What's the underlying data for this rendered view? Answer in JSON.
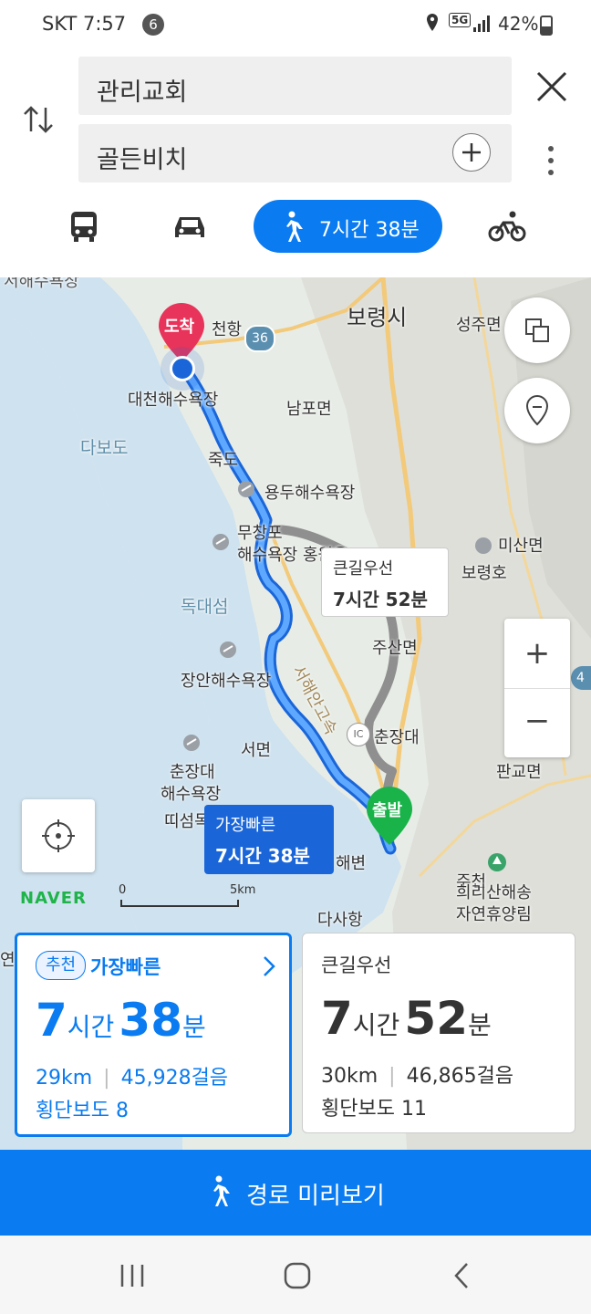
{
  "status": {
    "carrier": "SKT",
    "time": "7:57",
    "notification_count": "6",
    "network": "5G",
    "battery": "42%"
  },
  "search": {
    "origin": "관리교회",
    "destination": "골든비치"
  },
  "modes": {
    "walk_time": "7시간 38분"
  },
  "map": {
    "places": {
      "boryeong": "보령시",
      "seongju": "성주면",
      "cheonhang": "천항",
      "route36": "36",
      "daecheon_beach": "대천해수욕장",
      "dabodo": "다보도",
      "nampo": "남포면",
      "jukdo": "죽도",
      "yongdu_beach": "용두해수욕장",
      "muchangpo": "무창포",
      "muchangpo_beach": "해수욕장 홍원읍",
      "misan": "미산면",
      "boryeongho": "보령호",
      "dokdaeseom": "독대섬",
      "jusan": "주산면",
      "seohae_exp": "서해안고속",
      "janghang_beach": "장안해수욕장",
      "chunjang_dae": "춘장대",
      "seomyeon": "서면",
      "chunjang_beach1": "춘장대",
      "chunjang_beach2": "해수욕장",
      "ttiseom": "띠섬목해변",
      "hwaebyeon": "해변",
      "dasahang": "다사항",
      "pangyo": "판교면",
      "huirisan1": "희리산해송",
      "huirisan2": "자연휴양림",
      "jucheon": "주천",
      "ic": "IC",
      "yeon": "연",
      "top_cut": "서해수욕장",
      "route_left_small": "4"
    },
    "arrival_marker": "도착",
    "departure_marker": "출발",
    "alt_label": {
      "name": "큰길우선",
      "time": "7시간 52분"
    },
    "main_label": {
      "name": "가장빠른",
      "time": "7시간 38분"
    },
    "naver_logo": "NAVER",
    "scale": {
      "zero": "0",
      "max": "5km"
    },
    "zoom_in": "+",
    "zoom_out": "−"
  },
  "cards": [
    {
      "badge": "추천",
      "title": "가장빠른",
      "hours": "7",
      "hour_unit": "시간",
      "minutes": "38",
      "minute_unit": "분",
      "distance": "29km",
      "steps": "45,928걸음",
      "crosswalks": "횡단보도 8"
    },
    {
      "title": "큰길우선",
      "hours": "7",
      "hour_unit": "시간",
      "minutes": "52",
      "minute_unit": "분",
      "distance": "30km",
      "steps": "46,865걸음",
      "crosswalks": "횡단보도 11"
    }
  ],
  "preview_button": "경로 미리보기",
  "colors": {
    "accent": "#0a7bf0",
    "arrival": "#e8345a",
    "departure": "#19b34a"
  }
}
